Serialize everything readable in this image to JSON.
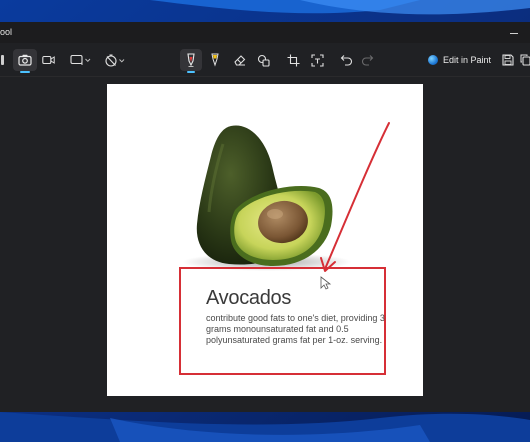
{
  "window": {
    "title": "ool",
    "minimize_icon": "minimize-icon"
  },
  "toolbar": {
    "left_edge_icon": "toolbar-edge-icon",
    "screenshot_mode_icon": "camera-icon",
    "video_mode_icon": "video-camera-icon",
    "snip_shape_icon": "rectangle-snip-icon",
    "delay_icon": "no-timer-icon",
    "ballpoint_pen_icon": "ballpoint-pen-icon",
    "pen_color": "#e03a3a",
    "highlighter_icon": "highlighter-icon",
    "highlighter_color": "#f2c21b",
    "eraser_icon": "eraser-icon",
    "shapes_icon": "shapes-icon",
    "crop_icon": "crop-icon",
    "text_actions_icon": "text-actions-icon",
    "undo_icon": "undo-icon",
    "redo_icon": "redo-icon",
    "edit_in_paint_label": "Edit in Paint",
    "paint_icon": "paint-icon",
    "save_icon": "save-icon",
    "copy_icon": "copy-icon"
  },
  "capture": {
    "heading": "Avocados",
    "body": "contribute good fats to one's diet, providing 3 grams monounsaturated fat and 0.5 polyunsaturated grams fat per 1-oz. serving.",
    "annotation_color": "#d62f36"
  },
  "colors": {
    "window_background": "#202124",
    "accent": "#4cc2ff"
  }
}
